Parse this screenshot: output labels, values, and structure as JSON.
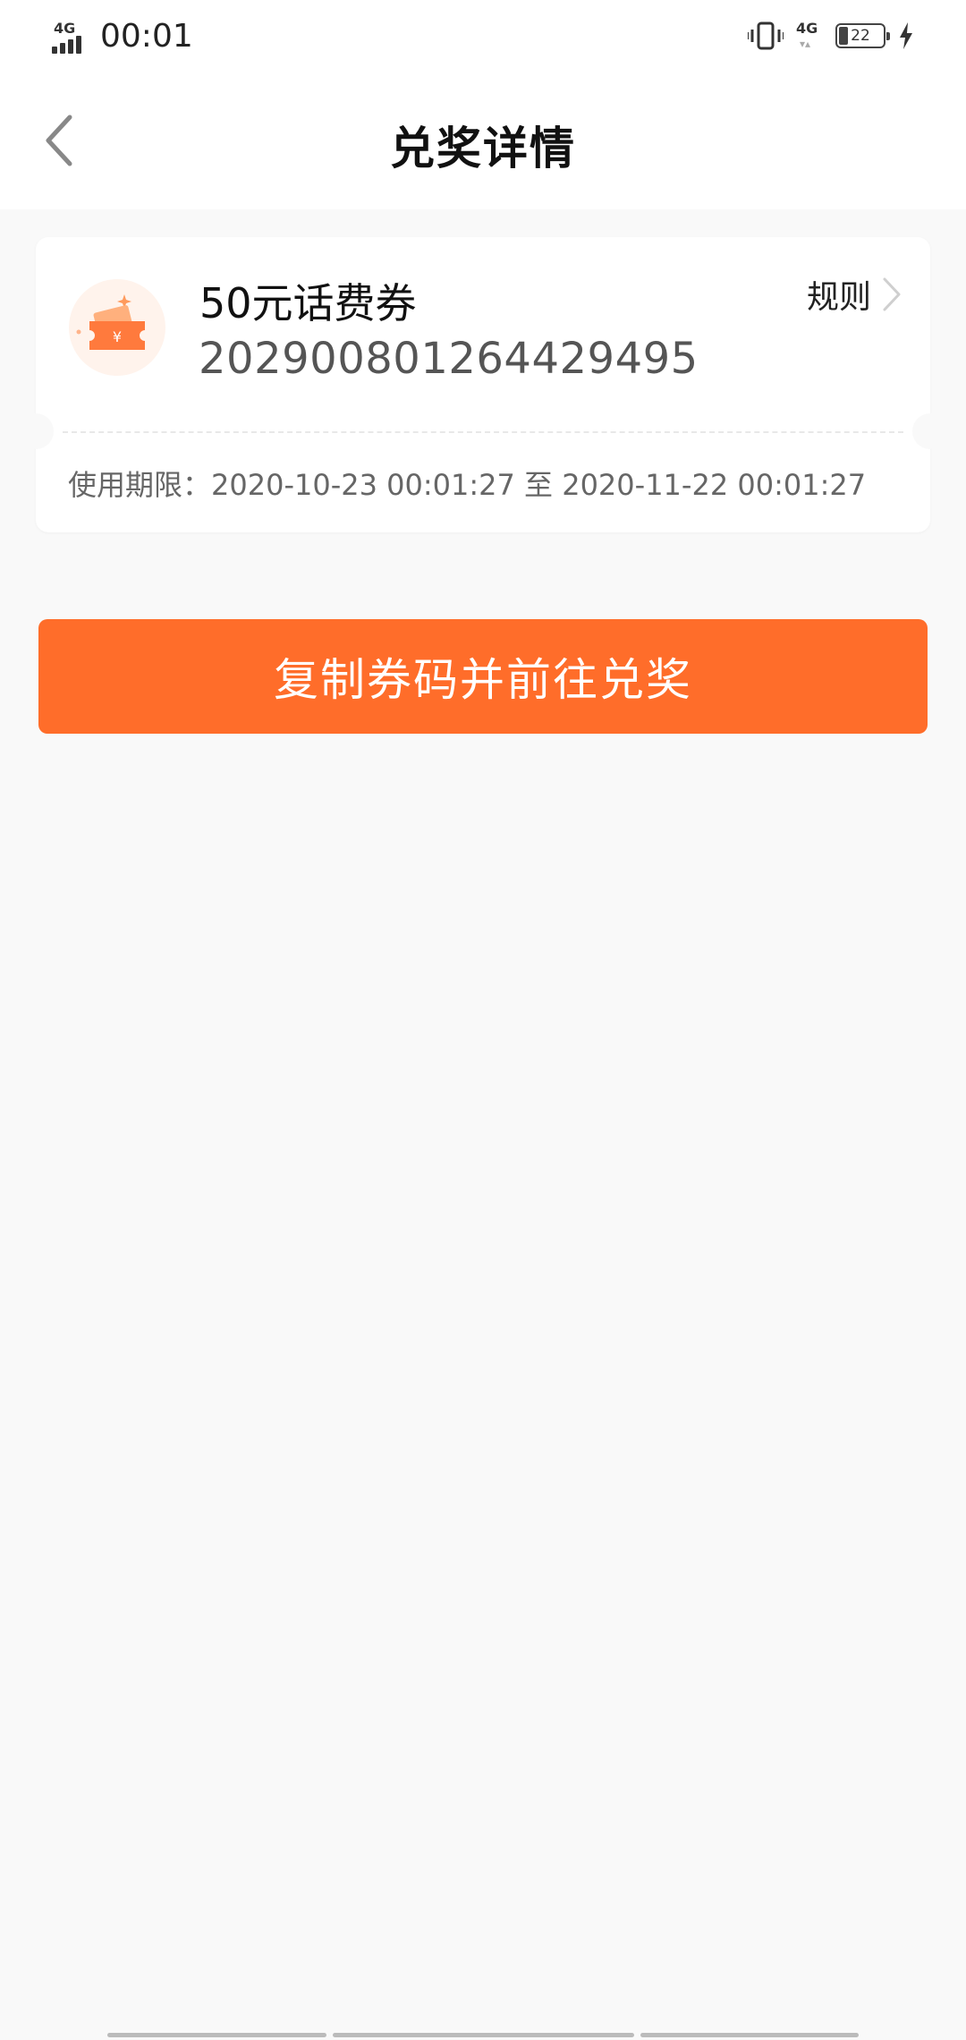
{
  "status_bar": {
    "time": "00:01",
    "network_left": "4G",
    "network_right": "4G",
    "battery_level": "22"
  },
  "header": {
    "title": "兑奖详情",
    "back_icon": "chevron-left-icon"
  },
  "coupon": {
    "name": "50元话费券",
    "code": "2029008012644294​95",
    "rules_label": "规则",
    "validity": "使用期限：2020-10-23 00:01:27 至 2020-11-22 00:01:27",
    "icon": "coupon-ticket-icon",
    "accent_color": "#ff7a3d"
  },
  "action": {
    "button_label": "复制券码并前往兑奖",
    "button_color": "#ff6d2a"
  }
}
